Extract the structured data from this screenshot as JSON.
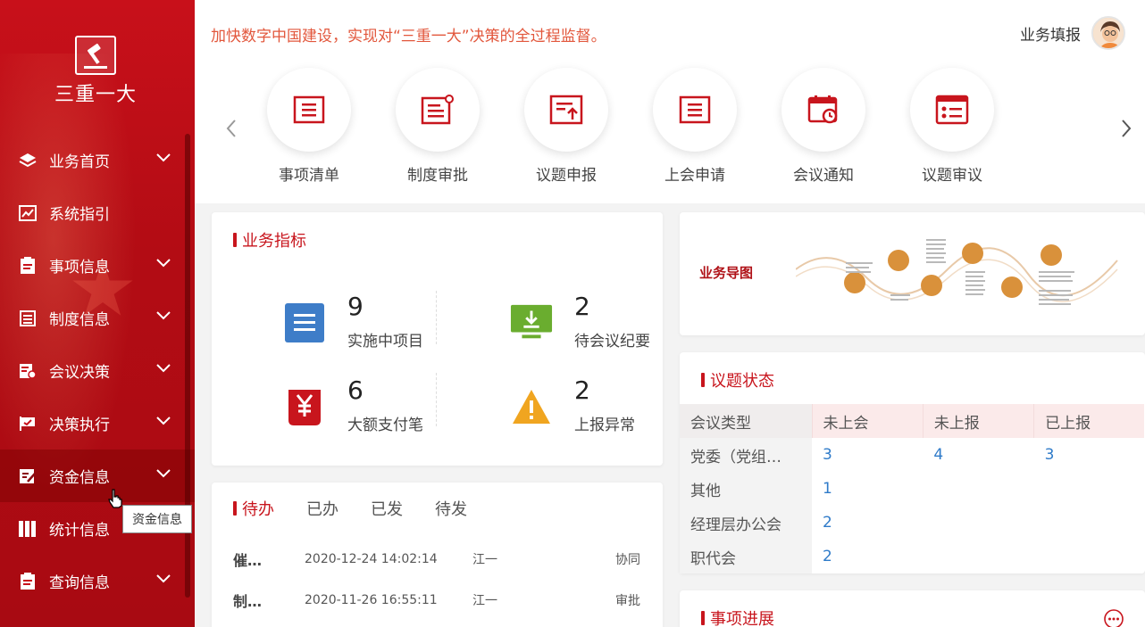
{
  "sidebar": {
    "logo_text": "三重一大",
    "items": [
      {
        "label": "业务首页",
        "icon": "layers-icon",
        "chevron": true
      },
      {
        "label": "系统指引",
        "icon": "chart-icon",
        "chevron": false
      },
      {
        "label": "事项信息",
        "icon": "document-icon",
        "chevron": true
      },
      {
        "label": "制度信息",
        "icon": "list-icon",
        "chevron": true
      },
      {
        "label": "会议决策",
        "icon": "meeting-icon",
        "chevron": true
      },
      {
        "label": "决策执行",
        "icon": "flag-icon",
        "chevron": true
      },
      {
        "label": "资金信息",
        "icon": "edit-icon",
        "chevron": true
      },
      {
        "label": "统计信息",
        "icon": "bars-icon",
        "chevron": false
      },
      {
        "label": "查询信息",
        "icon": "document-icon",
        "chevron": true
      }
    ],
    "tooltip": "资金信息"
  },
  "header": {
    "slogan": "加快数字中国建设，实现对“三重一大”决策的全过程监督。",
    "user_name": "业务填报"
  },
  "quick_links": [
    "事项清单",
    "制度审批",
    "议题申报",
    "上会申请",
    "会议通知",
    "议题审议"
  ],
  "metrics": {
    "title": "业务指标",
    "items": [
      {
        "value": "9",
        "label": "实施中项目"
      },
      {
        "value": "2",
        "label": "待会议纪要"
      },
      {
        "value": "6",
        "label": "大额支付笔"
      },
      {
        "value": "2",
        "label": "上报异常"
      }
    ]
  },
  "business_map": {
    "title": "业务导图"
  },
  "issue_status": {
    "title": "议题状态",
    "columns": [
      "会议类型",
      "未上会",
      "未上报",
      "已上报"
    ],
    "rows": [
      [
        "党委（党组…",
        "3",
        "4",
        "3"
      ],
      [
        "其他",
        "1",
        "",
        ""
      ],
      [
        "经理层办公会",
        "2",
        "",
        ""
      ],
      [
        "职代会",
        "2",
        "",
        ""
      ]
    ]
  },
  "todo": {
    "tabs": [
      "待办",
      "已办",
      "已发",
      "待发"
    ],
    "rows": [
      {
        "title": "催…",
        "time": "2020-12-24 14:02:14",
        "user": "江一",
        "type": "协同"
      },
      {
        "title": "制…",
        "time": "2020-11-26 16:55:11",
        "user": "江一",
        "type": "审批"
      }
    ]
  },
  "progress": {
    "title": "事项进展"
  },
  "colors": {
    "brand_red": "#c8151d",
    "slogan": "#e2573c",
    "link_blue": "#2f7bc9"
  }
}
